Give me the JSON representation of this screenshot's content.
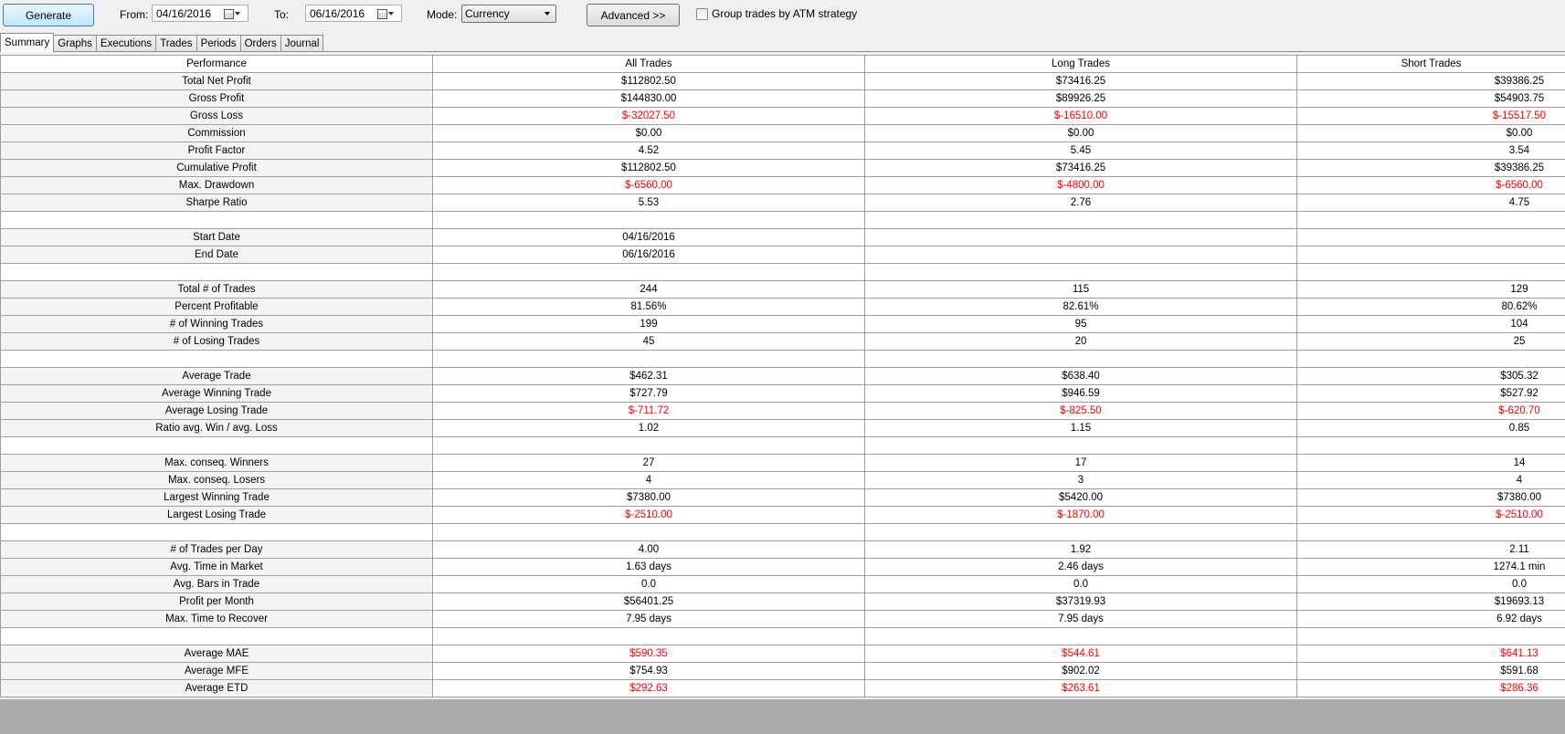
{
  "toolbar": {
    "generate_label": "Generate",
    "from_label": "From:",
    "from_value": "04/16/2016",
    "to_label": "To:",
    "to_value": "06/16/2016",
    "mode_label": "Mode:",
    "mode_value": "Currency",
    "advanced_label": "Advanced >>",
    "group_label": "Group trades by ATM strategy"
  },
  "tabs": [
    "Summary",
    "Graphs",
    "Executions",
    "Trades",
    "Periods",
    "Orders",
    "Journal"
  ],
  "table": {
    "headers": [
      "Performance",
      "All Trades",
      "Long Trades",
      "Short Trades"
    ],
    "rows": [
      {
        "label": "Total Net Profit",
        "values": [
          "$112802.50",
          "$73416.25",
          "$39386.25"
        ],
        "neg": [
          false,
          false,
          false
        ]
      },
      {
        "label": "Gross Profit",
        "values": [
          "$144830.00",
          "$89926.25",
          "$54903.75"
        ],
        "neg": [
          false,
          false,
          false
        ]
      },
      {
        "label": "Gross Loss",
        "values": [
          "$-32027.50",
          "$-16510.00",
          "$-15517.50"
        ],
        "neg": [
          true,
          true,
          true
        ]
      },
      {
        "label": "Commission",
        "values": [
          "$0.00",
          "$0.00",
          "$0.00"
        ],
        "neg": [
          false,
          false,
          false
        ]
      },
      {
        "label": "Profit Factor",
        "values": [
          "4.52",
          "5.45",
          "3.54"
        ],
        "neg": [
          false,
          false,
          false
        ]
      },
      {
        "label": "Cumulative Profit",
        "values": [
          "$112802.50",
          "$73416.25",
          "$39386.25"
        ],
        "neg": [
          false,
          false,
          false
        ]
      },
      {
        "label": "Max. Drawdown",
        "values": [
          "$-6560.00",
          "$-4800.00",
          "$-6560.00"
        ],
        "neg": [
          true,
          true,
          true
        ]
      },
      {
        "label": "Sharpe Ratio",
        "values": [
          "5.53",
          "2.76",
          "4.75"
        ],
        "neg": [
          false,
          false,
          false
        ]
      },
      {
        "label": "",
        "values": [
          "",
          "",
          ""
        ],
        "neg": [
          false,
          false,
          false
        ]
      },
      {
        "label": "Start Date",
        "values": [
          "04/16/2016",
          "",
          ""
        ],
        "neg": [
          false,
          false,
          false
        ]
      },
      {
        "label": "End Date",
        "values": [
          "06/16/2016",
          "",
          ""
        ],
        "neg": [
          false,
          false,
          false
        ]
      },
      {
        "label": "",
        "values": [
          "",
          "",
          ""
        ],
        "neg": [
          false,
          false,
          false
        ]
      },
      {
        "label": "Total # of Trades",
        "values": [
          "244",
          "115",
          "129"
        ],
        "neg": [
          false,
          false,
          false
        ]
      },
      {
        "label": "Percent Profitable",
        "values": [
          "81.56%",
          "82.61%",
          "80.62%"
        ],
        "neg": [
          false,
          false,
          false
        ]
      },
      {
        "label": "# of Winning Trades",
        "values": [
          "199",
          "95",
          "104"
        ],
        "neg": [
          false,
          false,
          false
        ]
      },
      {
        "label": "# of Losing Trades",
        "values": [
          "45",
          "20",
          "25"
        ],
        "neg": [
          false,
          false,
          false
        ]
      },
      {
        "label": "",
        "values": [
          "",
          "",
          ""
        ],
        "neg": [
          false,
          false,
          false
        ]
      },
      {
        "label": "Average Trade",
        "values": [
          "$462.31",
          "$638.40",
          "$305.32"
        ],
        "neg": [
          false,
          false,
          false
        ]
      },
      {
        "label": "Average Winning Trade",
        "values": [
          "$727.79",
          "$946.59",
          "$527.92"
        ],
        "neg": [
          false,
          false,
          false
        ]
      },
      {
        "label": "Average Losing Trade",
        "values": [
          "$-711.72",
          "$-825.50",
          "$-620.70"
        ],
        "neg": [
          true,
          true,
          true
        ]
      },
      {
        "label": "Ratio avg. Win / avg. Loss",
        "values": [
          "1.02",
          "1.15",
          "0.85"
        ],
        "neg": [
          false,
          false,
          false
        ]
      },
      {
        "label": "",
        "values": [
          "",
          "",
          ""
        ],
        "neg": [
          false,
          false,
          false
        ]
      },
      {
        "label": "Max. conseq. Winners",
        "values": [
          "27",
          "17",
          "14"
        ],
        "neg": [
          false,
          false,
          false
        ]
      },
      {
        "label": "Max. conseq. Losers",
        "values": [
          "4",
          "3",
          "4"
        ],
        "neg": [
          false,
          false,
          false
        ]
      },
      {
        "label": "Largest Winning Trade",
        "values": [
          "$7380.00",
          "$5420.00",
          "$7380.00"
        ],
        "neg": [
          false,
          false,
          false
        ]
      },
      {
        "label": "Largest Losing Trade",
        "values": [
          "$-2510.00",
          "$-1870.00",
          "$-2510.00"
        ],
        "neg": [
          true,
          true,
          true
        ]
      },
      {
        "label": "",
        "values": [
          "",
          "",
          ""
        ],
        "neg": [
          false,
          false,
          false
        ]
      },
      {
        "label": "# of Trades per Day",
        "values": [
          "4.00",
          "1.92",
          "2.11"
        ],
        "neg": [
          false,
          false,
          false
        ]
      },
      {
        "label": "Avg. Time in Market",
        "values": [
          "1.63 days",
          "2.46 days",
          "1274.1 min"
        ],
        "neg": [
          false,
          false,
          false
        ]
      },
      {
        "label": "Avg. Bars in Trade",
        "values": [
          "0.0",
          "0.0",
          "0.0"
        ],
        "neg": [
          false,
          false,
          false
        ]
      },
      {
        "label": "Profit per Month",
        "values": [
          "$56401.25",
          "$37319.93",
          "$19693.13"
        ],
        "neg": [
          false,
          false,
          false
        ]
      },
      {
        "label": "Max. Time to Recover",
        "values": [
          "7.95 days",
          "7.95 days",
          "6.92 days"
        ],
        "neg": [
          false,
          false,
          false
        ]
      },
      {
        "label": "",
        "values": [
          "",
          "",
          ""
        ],
        "neg": [
          false,
          false,
          false
        ]
      },
      {
        "label": "Average MAE",
        "values": [
          "$590.35",
          "$544.61",
          "$641.13"
        ],
        "neg": [
          true,
          true,
          true
        ]
      },
      {
        "label": "Average MFE",
        "values": [
          "$754.93",
          "$902.02",
          "$591.68"
        ],
        "neg": [
          false,
          false,
          false
        ]
      },
      {
        "label": "Average ETD",
        "values": [
          "$292.63",
          "$263.61",
          "$286.36"
        ],
        "neg": [
          true,
          true,
          true
        ]
      }
    ]
  },
  "colors": {
    "negative": "#ff0000",
    "background": "#f0f0f0",
    "empty_area": "#ababab"
  }
}
